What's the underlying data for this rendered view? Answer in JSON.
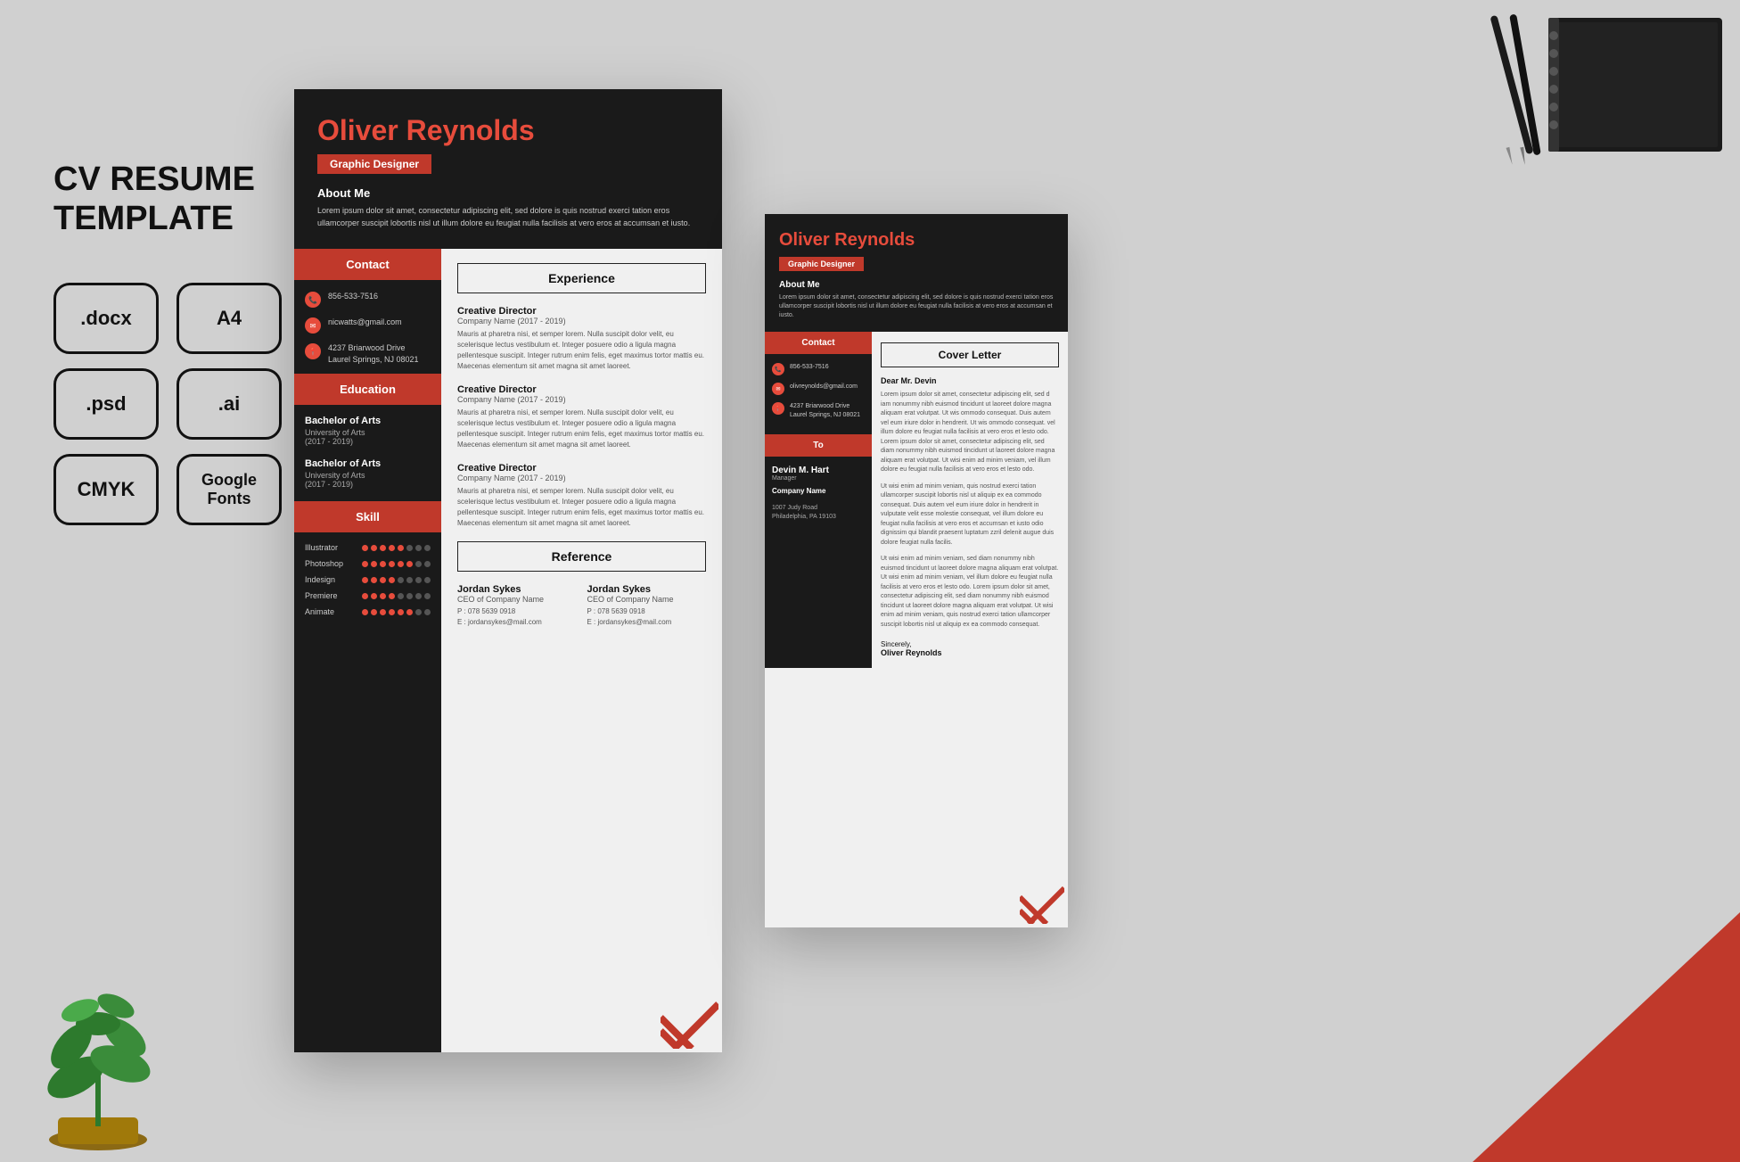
{
  "page": {
    "background_color": "#c8c8c8"
  },
  "left_panel": {
    "title": "CV RESUME\nTEMPLATE",
    "formats": [
      {
        "label": ".docx"
      },
      {
        "label": "A4"
      },
      {
        "label": ".psd"
      },
      {
        "label": ".ai"
      },
      {
        "label": "CMYK"
      },
      {
        "label": "Google\nFonts"
      }
    ]
  },
  "resume": {
    "name_first": "Oliver",
    "name_last": " Reynolds",
    "job_title": "Graphic Designer",
    "about_me_label": "About Me",
    "about_me_text": "Lorem ipsum dolor sit amet, consectetur adipiscing elit, sed dolore is quis nostrud exerci tation eros ullamcorper suscipit lobortis nisl ut illum dolore eu feugiat nulla facilisis at vero eros at accumsan et iusto.",
    "contact": {
      "label": "Contact",
      "phone": "856-533-7516",
      "email": "nicwatts@gmail.com",
      "address_line1": "4237 Briarwood Drive",
      "address_line2": "Laurel Springs, NJ 08021"
    },
    "education": {
      "label": "Education",
      "items": [
        {
          "degree": "Bachelor of Arts",
          "school": "University of Arts",
          "years": "(2017 - 2019)"
        },
        {
          "degree": "Bachelor of Arts",
          "school": "University of Arts",
          "years": "(2017 - 2019)"
        }
      ]
    },
    "skill": {
      "label": "Skill",
      "items": [
        {
          "name": "Illustrator",
          "filled": 5,
          "empty": 3
        },
        {
          "name": "Photoshop",
          "filled": 6,
          "empty": 2
        },
        {
          "name": "Indesign",
          "filled": 4,
          "empty": 4
        },
        {
          "name": "Premiere",
          "filled": 4,
          "empty": 4
        },
        {
          "name": "Animate",
          "filled": 6,
          "empty": 2
        }
      ]
    },
    "experience": {
      "label": "Experience",
      "items": [
        {
          "title": "Creative Director",
          "company": "Company Name   (2017 - 2019)",
          "desc": "Mauris at pharetra nisi, et semper lorem. Nulla suscipit dolor velit, eu scelerisque lectus vestibulum et. Integer posuere odio a ligula magna pellentesque suscipit. Integer rutrum enim felis, eget maximus tortor mattis eu. Maecenas elementum sit amet magna sit amet laoreet."
        },
        {
          "title": "Creative Director",
          "company": "Company Name   (2017 - 2019)",
          "desc": "Mauris at pharetra nisi, et semper lorem. Nulla suscipit dolor velit, eu scelerisque lectus vestibulum et. Integer posuere odio a ligula magna pellentesque suscipit. Integer rutrum enim felis, eget maximus tortor mattis eu. Maecenas elementum sit amet magna sit amet laoreet."
        },
        {
          "title": "Creative Director",
          "company": "Company Name   (2017 - 2019)",
          "desc": "Mauris at pharetra nisi, et semper lorem. Nulla suscipit dolor velit, eu scelerisque lectus vestibulum et. Integer posuere odio a ligula magna pellentesque suscipit. Integer rutrum enim felis, eget maximus tortor mattis eu. Maecenas elementum sit amet magna sit amet laoreet."
        }
      ]
    },
    "reference": {
      "label": "Reference",
      "items": [
        {
          "name": "Jordan Sykes",
          "title": "CEO of Company Name",
          "phone": "P : 078 5639 0918",
          "email": "E : jordansykes@mail.com"
        },
        {
          "name": "Jordan Sykes",
          "title": "CEO of Company Name",
          "phone": "P : 078 5639 0918",
          "email": "E : jordansykes@mail.com"
        }
      ]
    }
  },
  "cover_letter": {
    "name_first": "Oliver",
    "name_last": " Reynolds",
    "job_title": "Graphic Designer",
    "about_me_label": "About Me",
    "about_me_text": "Lorem ipsum dolor sit amet, consectetur adipiscing elit, sed dolore is quis nostrud exerci tation eros ullamcorper suscipit lobortis nisl ut illum dolore eu feugiat nulla facilisis at vero eros at accumsan et iusto.",
    "contact": {
      "label": "Contact",
      "phone": "856-533-7516",
      "email": "olivreynolds@gmail.com",
      "address_line1": "4237 Briarwood Drive",
      "address_line2": "Laurel Springs, NJ 08021"
    },
    "to_label": "To",
    "to_name": "Devin M. Hart",
    "to_role": "Manager",
    "to_company": "Company Name",
    "to_address": "1007 Judy Road\nPhiladelphia, PA 19103",
    "letter_label": "Cover Letter",
    "dear": "Dear Mr. Devin",
    "body1": "Lorem ipsum dolor sit amet, consectetur adipiscing elit, sed d iam nonummy nibh euismod tincidunt ut laoreet dolore magna aliquam erat volutpat. Ut wis ommodo consequat. Duis autem vel eum iriure dolor in hendrerit. Ut wis ommodo consequat. vel illum dolore eu feugiat nulla facilisis at vero eros et lesto odo. Lorem ipsum dolor sit amet, consectetur adipiscing elit, sed diam nonummy nibh euismod tincidunt ut laoreet dolore magna aliquam erat volutpat. Ut wisi enim ad minim veniam, vel illum dolore eu feugiat nulla facilisis at vero eros et lesto odo.",
    "body2": "Ut wisi enim ad minim veniam, quis nostrud exerci tation ullamcorper suscipit lobortis nisl ut aliquip ex ea commodo consequat. Duis autem vel eum iriure dolor in hendrerit in vulputate velit esse molestie consequat, vel illum dolore eu feugiat nulla facilisis at vero eros et accumsan et iusto odio dignissim qui blandit praesent luptatum zzril delenit augue duis dolore feugiat nulla facilis.",
    "body3": "Ut wisi enim ad minim veniam, sed diam nonummy nibh euismod tincidunt ut laoreet dolore magna aliquam erat volutpat. Ut wisi enim ad minim veniam, vel illum dolore eu feugiat nulla facilisis at vero eros et lesto odo. Lorem ipsum dolor sit amet, consectetur adipiscing elit, sed diam nonummy nibh euismod tincidunt ut laoreet dolore magna aliquam erat volutpat. Ut wisi enim ad minim veniam, quis nostrud exerci tation ullamcorper suscipit lobortis nisl ut aliquip ex ea commodo consequat.",
    "sincerely": "Sincerely,",
    "signature": "Oliver Reynolds"
  }
}
